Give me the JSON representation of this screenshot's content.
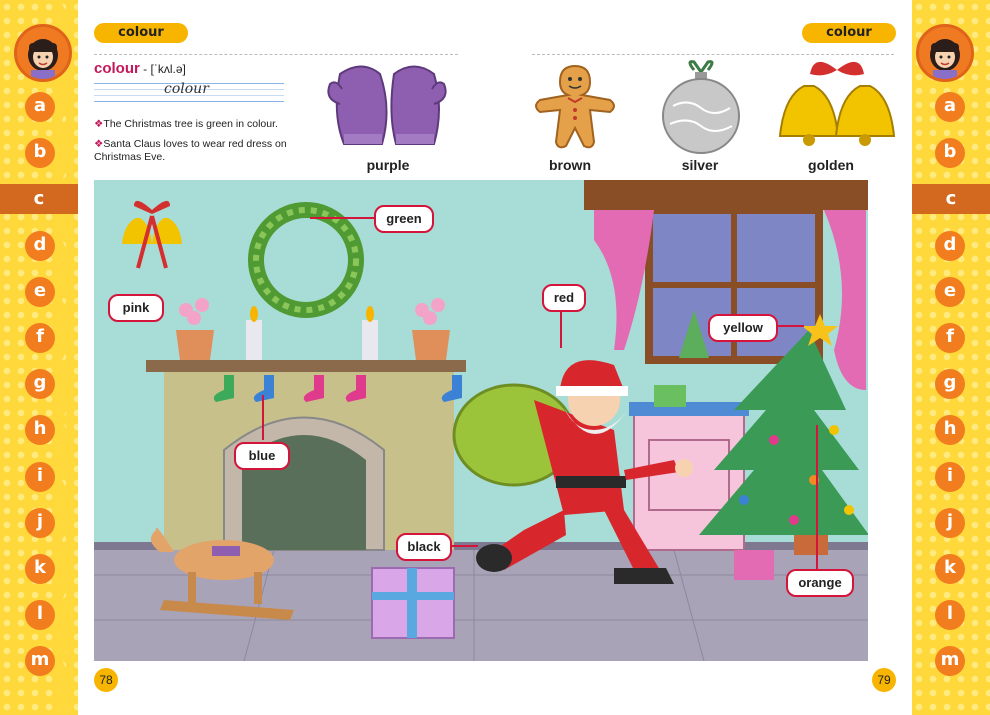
{
  "left_page": {
    "tag": "colour",
    "headword": "colour",
    "pronunciation": " - [ˈkʌl.ə]",
    "cursive": "colour",
    "sentences": [
      "The Christmas tree is green in colour.",
      "Santa Claus loves to wear red dress on Christmas Eve."
    ],
    "page_number": "78"
  },
  "right_page": {
    "tag": "colour",
    "page_number": "79"
  },
  "top_items": [
    {
      "label": "purple",
      "color": "#8e5fb0"
    },
    {
      "label": "brown",
      "color": "#e5a04a"
    },
    {
      "label": "silver",
      "color": "#c8c8c8"
    },
    {
      "label": "golden",
      "color": "#f2c400"
    }
  ],
  "scene_labels": [
    {
      "label": "green"
    },
    {
      "label": "pink"
    },
    {
      "label": "red"
    },
    {
      "label": "yellow"
    },
    {
      "label": "blue"
    },
    {
      "label": "black"
    },
    {
      "label": "orange"
    }
  ],
  "alphabet": [
    "a",
    "b",
    "c",
    "d",
    "e",
    "f",
    "g",
    "h",
    "i",
    "j",
    "k",
    "l",
    "m"
  ],
  "active_letter": "c",
  "colors": {
    "strip": "#ffd93b",
    "letter_bg": "#f27d1f",
    "tag_bg": "#f7b500",
    "headword": "#c2185b",
    "pill_border": "#d4143a"
  }
}
